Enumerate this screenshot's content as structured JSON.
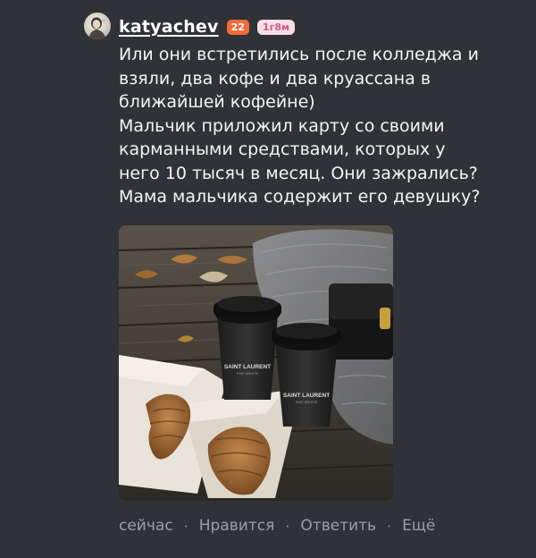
{
  "comment": {
    "author": {
      "username": "katyachev",
      "badge_count": "22",
      "time_badge": "1г8м"
    },
    "text_lines": [
      "Или они встретились после колледжа и",
      "взяли, два кофе и два круассана в",
      "ближайшей кофейне)",
      "Мальчик приложил карту со своими",
      "карманными средствами, которых у",
      "него 10 тысяч в месяц. Они зажрались?",
      "Мама мальчика содержит его девушку?"
    ],
    "photo": {
      "cup_brand": "SAINT LAURENT",
      "cup_sub": "RIVE DROITE"
    },
    "actions": {
      "time": "сейчас",
      "like": "Нравится",
      "reply": "Ответить",
      "more": "Ещё",
      "separator": "·"
    }
  }
}
